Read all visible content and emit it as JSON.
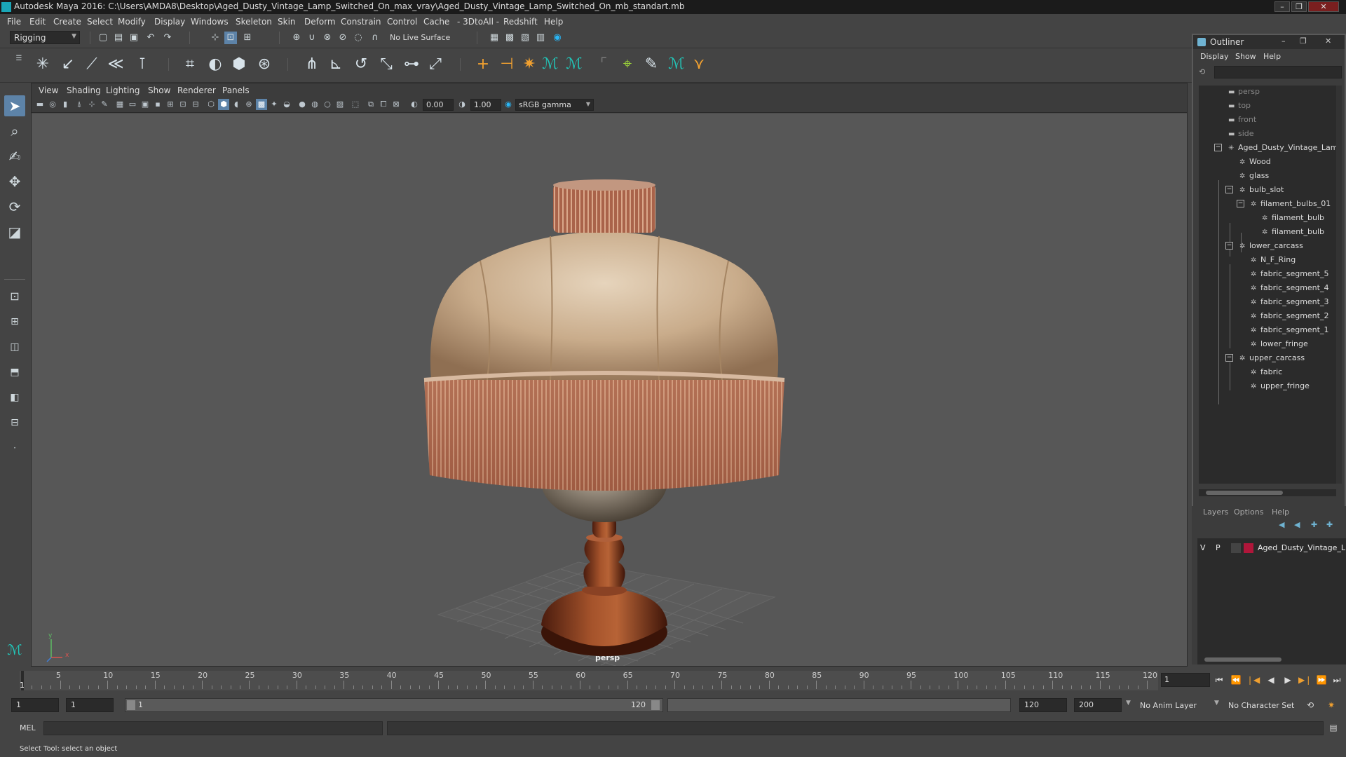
{
  "window": {
    "title": "Autodesk Maya 2016: C:\\Users\\AMDA8\\Desktop\\Aged_Dusty_Vintage_Lamp_Switched_On_max_vray\\Aged_Dusty_Vintage_Lamp_Switched_On_mb_standart.mb",
    "minimize_glyph": "–",
    "restore_glyph": "❐",
    "close_glyph": "✕"
  },
  "menubar": [
    "File",
    "Edit",
    "Create",
    "Select",
    "Modify",
    "Display",
    "Windows",
    "Skeleton",
    "Skin",
    "Deform",
    "Constrain",
    "Control",
    "Cache",
    "- 3DtoAll -",
    "Redshift",
    "Help"
  ],
  "statusline": {
    "mode_dropdown": "Rigging",
    "live_surface": "No Live Surface"
  },
  "viewport": {
    "menu": [
      "View",
      "Shading",
      "Lighting",
      "Show",
      "Renderer",
      "Panels"
    ],
    "exposure": "0.00",
    "gamma": "1.00",
    "color_space": "sRGB gamma",
    "camera_label": "persp",
    "axis_labels": {
      "x": "x",
      "y": "y"
    }
  },
  "outliner": {
    "title": "Outliner",
    "menu": [
      "Display",
      "Show",
      "Help"
    ],
    "tree": [
      {
        "label": "persp",
        "type": "camera",
        "depth": 0
      },
      {
        "label": "top",
        "type": "camera",
        "depth": 0
      },
      {
        "label": "front",
        "type": "camera",
        "depth": 0
      },
      {
        "label": "side",
        "type": "camera",
        "depth": 0
      },
      {
        "label": "Aged_Dusty_Vintage_Lam",
        "type": "root",
        "depth": 0,
        "expanded": true
      },
      {
        "label": "Wood",
        "type": "mesh",
        "depth": 1
      },
      {
        "label": "glass",
        "type": "mesh",
        "depth": 1
      },
      {
        "label": "bulb_slot",
        "type": "group",
        "depth": 1,
        "expanded": true
      },
      {
        "label": "filament_bulbs_01",
        "type": "group",
        "depth": 2,
        "expanded": true
      },
      {
        "label": "filament_bulb",
        "type": "mesh",
        "depth": 3
      },
      {
        "label": "filament_bulb",
        "type": "mesh",
        "depth": 3
      },
      {
        "label": "lower_carcass",
        "type": "group",
        "depth": 1,
        "expanded": true
      },
      {
        "label": "N_F_Ring",
        "type": "mesh",
        "depth": 2
      },
      {
        "label": "fabric_segment_5",
        "type": "mesh",
        "depth": 2
      },
      {
        "label": "fabric_segment_4",
        "type": "mesh",
        "depth": 2
      },
      {
        "label": "fabric_segment_3",
        "type": "mesh",
        "depth": 2
      },
      {
        "label": "fabric_segment_2",
        "type": "mesh",
        "depth": 2
      },
      {
        "label": "fabric_segment_1",
        "type": "mesh",
        "depth": 2
      },
      {
        "label": "lower_fringe",
        "type": "mesh",
        "depth": 2
      },
      {
        "label": "upper_carcass",
        "type": "group",
        "depth": 1,
        "expanded": true
      },
      {
        "label": "fabric",
        "type": "mesh",
        "depth": 2
      },
      {
        "label": "upper_fringe",
        "type": "mesh",
        "depth": 2
      }
    ]
  },
  "layers": {
    "menu": [
      "Layers",
      "Options",
      "Help"
    ],
    "row": {
      "v": "V",
      "p": "P",
      "name": "Aged_Dusty_Vintage_L",
      "color": "#b0163a"
    }
  },
  "timeline": {
    "ticks": [
      5,
      10,
      15,
      20,
      25,
      30,
      35,
      40,
      45,
      50,
      55,
      60,
      65,
      70,
      75,
      80,
      85,
      90,
      95,
      100,
      105,
      110,
      115,
      120
    ],
    "range_min": 1,
    "range_max": 120,
    "current_frame_label": "1",
    "current_frame_field": "1"
  },
  "range": {
    "start_field": "1",
    "playback_start_field": "1",
    "bar_start": "1",
    "bar_end": "120",
    "playback_end_field": "120",
    "end_field": "200",
    "anim_layer": "No Anim Layer",
    "character_set": "No Character Set"
  },
  "command": {
    "label": "MEL"
  },
  "help_line": "Select Tool: select an object"
}
